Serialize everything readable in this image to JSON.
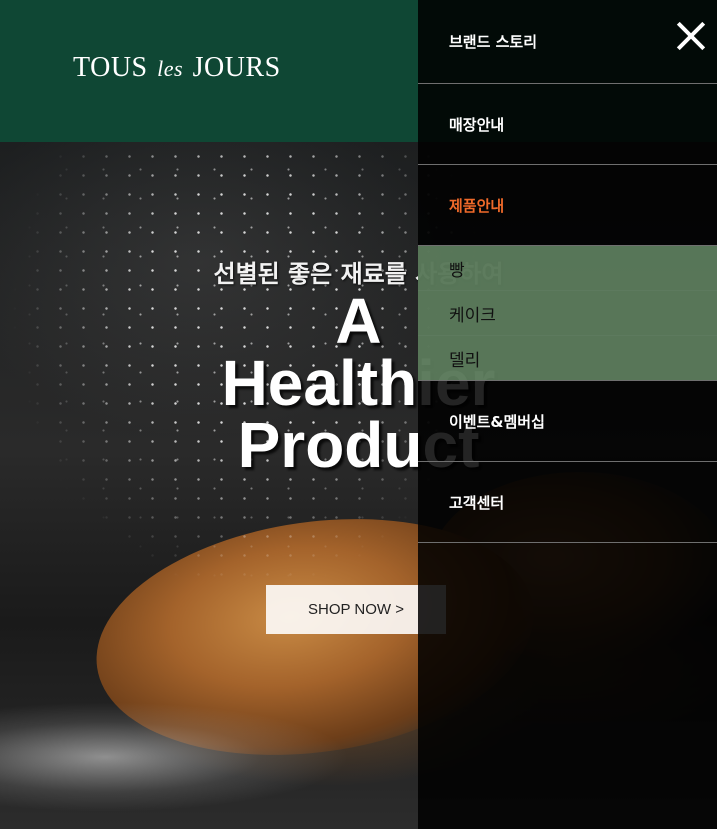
{
  "header": {
    "logo_left": "TOUS",
    "logo_mid": "les",
    "logo_right": "JOURS"
  },
  "hero": {
    "subtitle": "선별된 좋은 재료를 사용하여",
    "title_line1": "A",
    "title_line2": "Healthier",
    "title_line3": "Product",
    "button_label": "SHOP NOW >"
  },
  "menu": {
    "close_icon": "close-icon",
    "items": [
      {
        "label": "브랜드 스토리",
        "active": false
      },
      {
        "label": "매장안내",
        "active": false
      },
      {
        "label": "제품안내",
        "active": true
      },
      {
        "label": "이벤트&멤버십",
        "active": false
      },
      {
        "label": "고객센터",
        "active": false
      }
    ],
    "submenu": [
      {
        "label": "빵"
      },
      {
        "label": "케이크"
      },
      {
        "label": "델리"
      }
    ]
  },
  "colors": {
    "header_bg": "#0f4734",
    "active_menu": "#f06a2a",
    "submenu_bg": "#709670"
  }
}
